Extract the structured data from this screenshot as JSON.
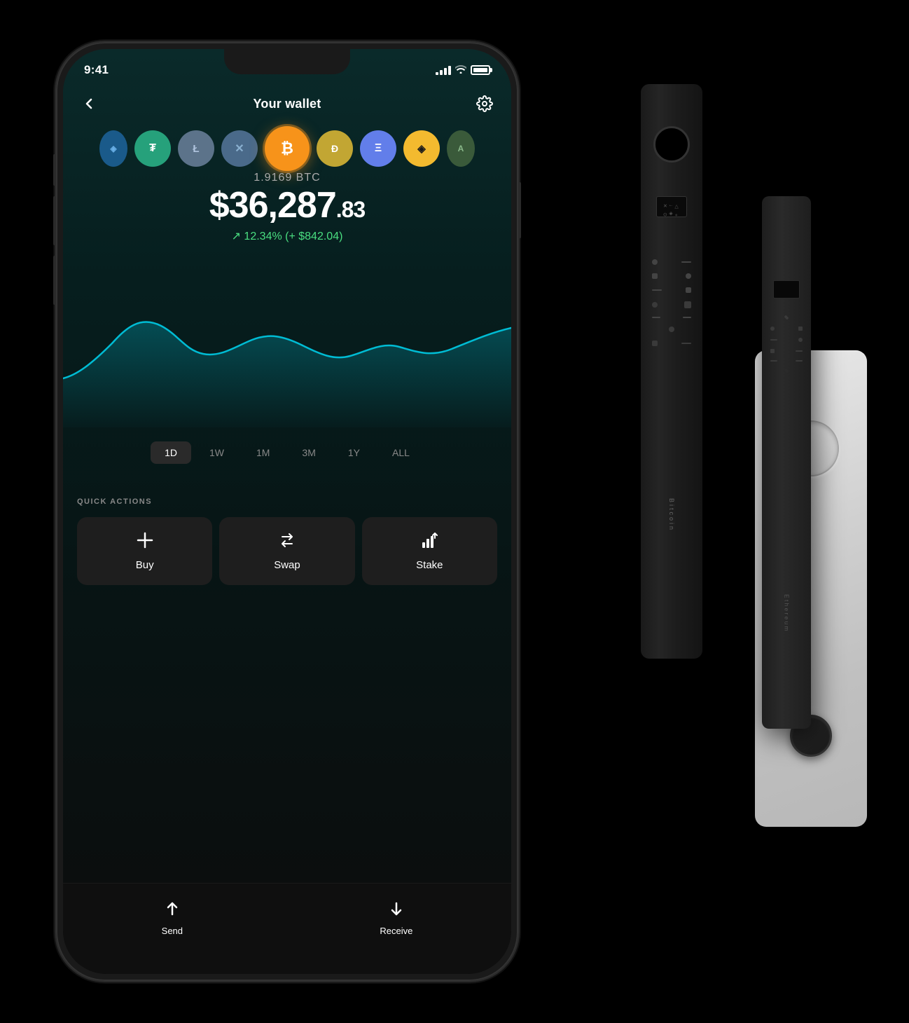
{
  "status_bar": {
    "time": "9:41"
  },
  "header": {
    "title": "Your wallet",
    "back_label": "←",
    "settings_label": "settings"
  },
  "crypto_coins": [
    {
      "id": "unknown",
      "color": "#1a5a8a",
      "symbol": "?"
    },
    {
      "id": "tether",
      "color": "#26a17b",
      "symbol": "₮"
    },
    {
      "id": "litecoin",
      "color": "#5c738a",
      "symbol": "Ł"
    },
    {
      "id": "ripple",
      "color": "#4a6a8a",
      "symbol": "✕"
    },
    {
      "id": "bitcoin",
      "color": "#f7931a",
      "symbol": "₿"
    },
    {
      "id": "dogecoin",
      "color": "#c2a633",
      "symbol": "Ð"
    },
    {
      "id": "ethereum",
      "color": "#627eea",
      "symbol": "Ξ"
    },
    {
      "id": "binance",
      "color": "#f3ba2f",
      "symbol": "◈"
    },
    {
      "id": "algo",
      "color": "#3a5a3a",
      "symbol": "A"
    }
  ],
  "balance": {
    "btc_amount": "1.9169 BTC",
    "usd_main": "$36,287",
    "usd_cents": ".83",
    "percent_change": "↗ 12.34% (+ $842.04)"
  },
  "chart": {
    "color": "#00bcd4"
  },
  "time_filters": [
    {
      "label": "1D",
      "active": true
    },
    {
      "label": "1W",
      "active": false
    },
    {
      "label": "1M",
      "active": false
    },
    {
      "label": "3M",
      "active": false
    },
    {
      "label": "1Y",
      "active": false
    },
    {
      "label": "ALL",
      "active": false
    }
  ],
  "quick_actions": {
    "label": "QUICK ACTIONS",
    "buttons": [
      {
        "id": "buy",
        "icon": "+",
        "label": "Buy"
      },
      {
        "id": "swap",
        "icon": "⇄",
        "label": "Swap"
      },
      {
        "id": "stake",
        "icon": "↑↑",
        "label": "Stake"
      }
    ]
  },
  "bottom_nav": [
    {
      "id": "send",
      "icon": "↑",
      "label": "Send"
    },
    {
      "id": "receive",
      "icon": "↓",
      "label": "Receive"
    }
  ],
  "ledger_devices": {
    "device1_text": "Bitcoin",
    "device2_text": "Ethereum"
  }
}
